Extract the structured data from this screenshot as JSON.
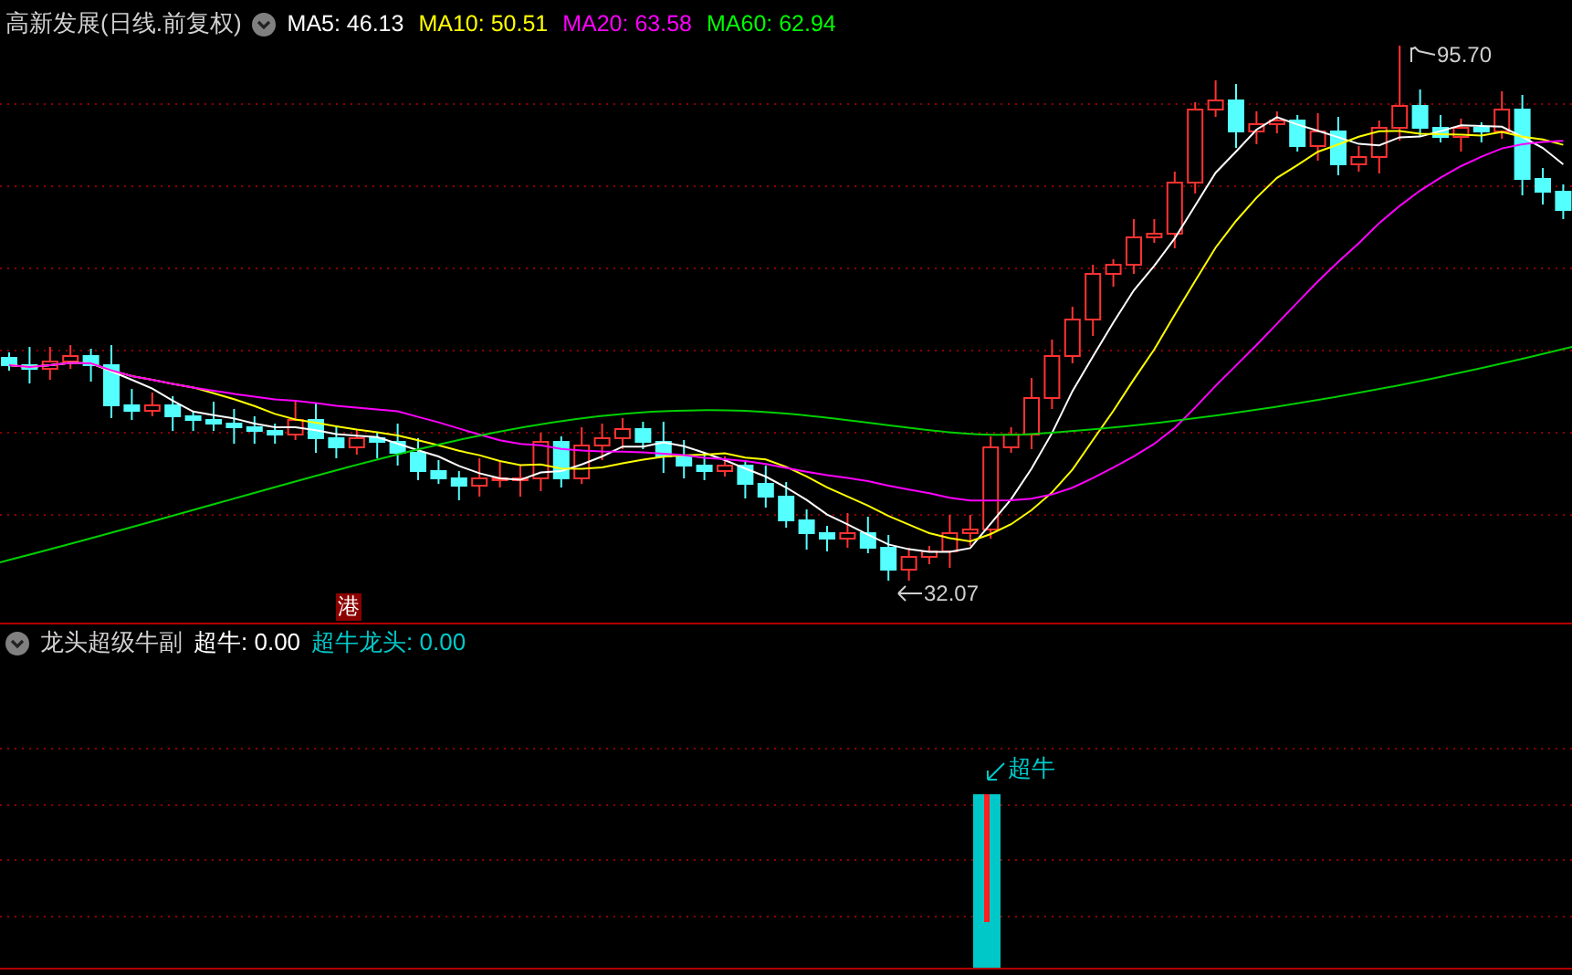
{
  "main_chart": {
    "title": "高新发展(日线.前复权)",
    "indicators": [
      {
        "label": "MA5: 46.13",
        "color": "#ffffff"
      },
      {
        "label": "MA10: 50.51",
        "color": "#ffff00"
      },
      {
        "label": "MA20: 63.58",
        "color": "#ff00ff"
      },
      {
        "label": "MA60: 62.94",
        "color": "#00ff00"
      }
    ],
    "high_label": "95.70",
    "low_label": "32.07",
    "badge": "港"
  },
  "sub_chart": {
    "title": "龙头超级牛副",
    "indicators": [
      {
        "label": "超牛: 0.00",
        "color": "#ffffff"
      },
      {
        "label": "超牛龙头: 0.00",
        "color": "#00c8c8"
      }
    ],
    "signal_label": "超牛"
  }
}
